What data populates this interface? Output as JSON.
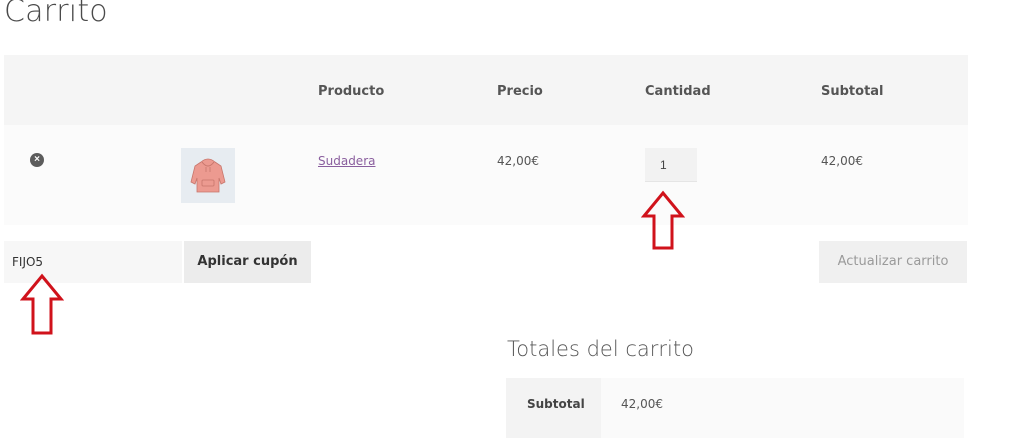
{
  "page": {
    "title": "Carrito"
  },
  "cart_table": {
    "headers": {
      "product": "Producto",
      "price": "Precio",
      "quantity": "Cantidad",
      "subtotal": "Subtotal"
    },
    "rows": [
      {
        "remove_symbol": "×",
        "thumbnail": "hoodie-image",
        "product": "Sudadera",
        "price": "42,00€",
        "quantity": "1",
        "subtotal": "42,00€"
      }
    ]
  },
  "actions": {
    "coupon_value": "FIJO5",
    "apply_coupon_label": "Aplicar cupón",
    "update_cart_label": "Actualizar carrito"
  },
  "totals": {
    "title": "Totales del carrito",
    "subtotal_label": "Subtotal",
    "subtotal_value": "42,00€"
  },
  "annotations": {
    "arrow_color": "#d0121b"
  }
}
